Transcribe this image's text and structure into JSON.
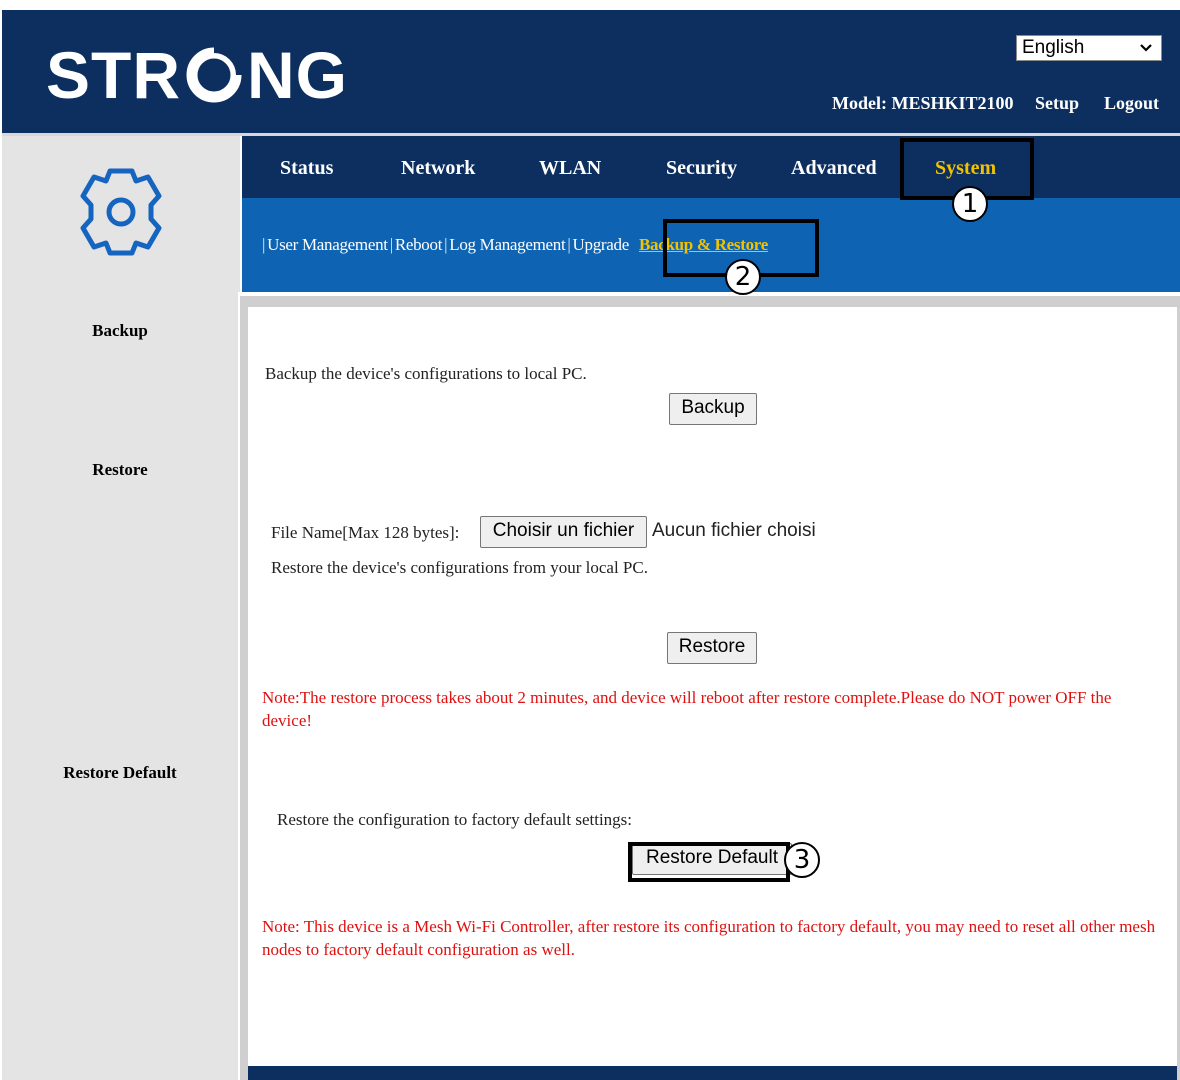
{
  "header": {
    "logo_left": "STR",
    "logo_right": "NG",
    "language": "English",
    "model_label": "Model: MESHKIT2100",
    "setup_label": "Setup",
    "logout_label": "Logout"
  },
  "nav": {
    "items": [
      "Status",
      "Network",
      "WLAN",
      "Security",
      "Advanced",
      "System"
    ],
    "active": "System"
  },
  "subnav": {
    "items": [
      "User Management",
      "Reboot",
      "Log Management",
      "Upgrade"
    ],
    "separator": "|",
    "active": "Backup & Restore"
  },
  "sidebar": {
    "backup": "Backup",
    "restore": "Restore",
    "restore_default": "Restore Default"
  },
  "backup": {
    "description": "Backup the device's configurations to local PC.",
    "button": "Backup"
  },
  "restore": {
    "file_label": "File Name[Max 128 bytes]:",
    "file_button": "Choisir un fichier",
    "file_status": "Aucun fichier choisi",
    "description": "Restore the device's configurations from your local PC.",
    "button": "Restore",
    "note": "Note:The restore process takes about 2 minutes, and device will reboot after restore complete.Please do NOT power OFF the device!"
  },
  "restore_default": {
    "description": "Restore the configuration to factory default settings:",
    "button": "Restore Default",
    "note": "Note: This device is a Mesh Wi-Fi Controller, after restore its configuration to factory default, you may need to reset all other mesh nodes to factory default configuration as well."
  },
  "annotations": [
    "1",
    "2",
    "3"
  ]
}
